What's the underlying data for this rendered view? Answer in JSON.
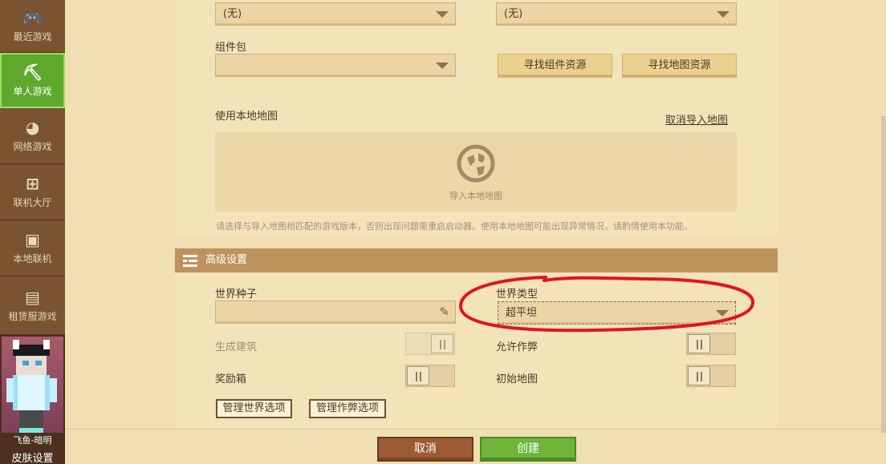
{
  "sidebar": {
    "items": [
      {
        "label": "最近游戏",
        "icon": "gamepad-icon",
        "glyph": "🎮"
      },
      {
        "label": "单人游戏",
        "icon": "pickaxe-icon",
        "glyph": "⛏"
      },
      {
        "label": "网络游戏",
        "icon": "globe-icon",
        "glyph": "◕"
      },
      {
        "label": "联机大厅",
        "icon": "lobby-icon",
        "glyph": "⊞"
      },
      {
        "label": "本地联机",
        "icon": "monitor-icon",
        "glyph": "▣"
      },
      {
        "label": "租赁服游戏",
        "icon": "server-list-icon",
        "glyph": "▤"
      }
    ],
    "active_index": 1,
    "skin_name": "飞鱼-暗明",
    "skin_settings": "皮肤设置"
  },
  "form": {
    "dropdown_left_value": "(无)",
    "dropdown_right_value": "(无)",
    "addon_pack_label": "组件包",
    "addon_pack_value": "",
    "find_addon_button": "寻找组件资源",
    "find_map_button": "寻找地图资源",
    "local_map_label": "使用本地地图",
    "cancel_import_link": "取消导入地图",
    "import_local_map": "导入本地地图",
    "warning_text": "请选择与导入地图相匹配的游戏版本，否则出现问题需重启启动器。使用本地地图可能出现异常情况，请酌情使用本功能。"
  },
  "advanced": {
    "title": "高级设置",
    "seed_label": "世界种子",
    "seed_value": "",
    "world_type_label": "世界类型",
    "world_type_value": "超平坦",
    "generate_structures_label": "生成建筑",
    "generate_structures_enabled": false,
    "allow_cheats_label": "允许作弊",
    "allow_cheats_on": false,
    "bonus_chest_label": "奖励箱",
    "bonus_chest_on": false,
    "starting_map_label": "初始地图",
    "starting_map_on": false,
    "manage_world_options": "管理世界选项",
    "manage_cheat_options": "管理作弊选项"
  },
  "footer": {
    "cancel_label": "取消",
    "create_label": "创建"
  },
  "colors": {
    "accent_green": "#6fb53a",
    "cancel_brown": "#9d5a35",
    "annotation_red": "#e0141e"
  }
}
